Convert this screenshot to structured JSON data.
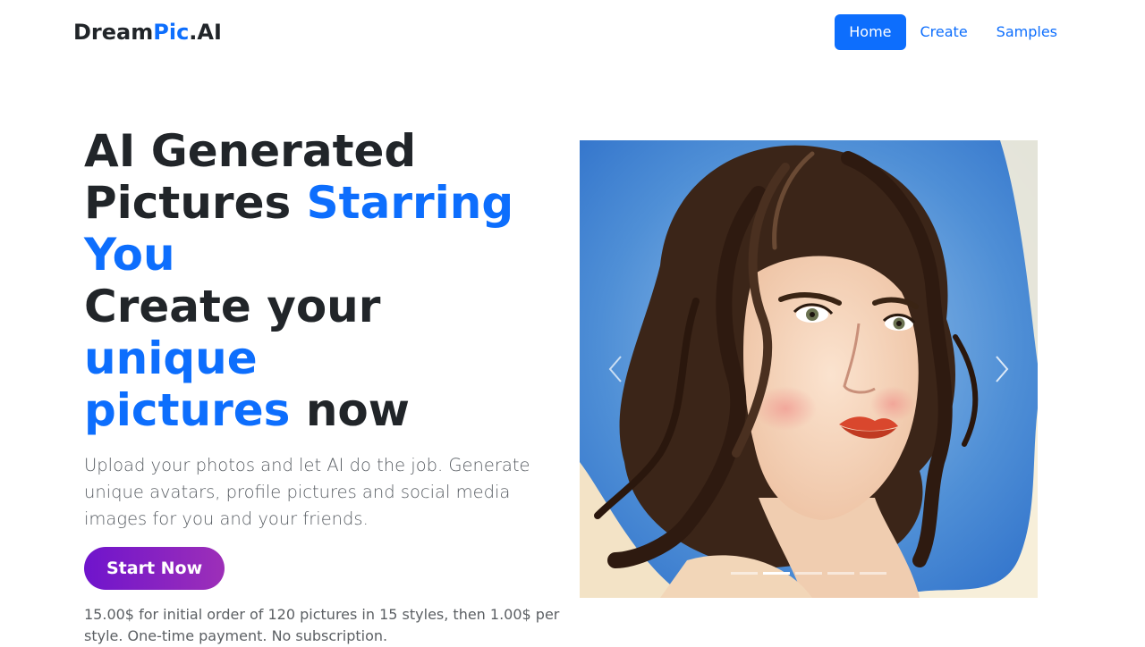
{
  "brand": {
    "part1": "Dream",
    "part2": "Pic",
    "part3": ".AI",
    "accent_color": "#0d6efd"
  },
  "nav": {
    "items": [
      {
        "label": "Home",
        "active": true
      },
      {
        "label": "Create",
        "active": false
      },
      {
        "label": "Samples",
        "active": false
      }
    ]
  },
  "hero": {
    "headline": {
      "line1": "AI Generated",
      "line2a": "Pictures ",
      "line2b": "Starring",
      "line3": "You",
      "line4a": "Create your ",
      "line4b": "unique",
      "line5a": "pictures",
      "line5b": " now"
    },
    "lead": "Upload your photos and let AI do the job. Generate unique avatars, profile pictures and social media images for you and your friends.",
    "cta_label": "Start Now",
    "cta_gradient": [
      "#6f14cc",
      "#9d2fb8"
    ],
    "note": "15.00$ for initial order of 120 pictures in 15 styles, then 1.00$ per style. One-time payment. No subscription."
  },
  "carousel": {
    "image_subject": "watercolor portrait of a woman with dark wavy hair on a blue background",
    "prev_icon": "chevron-left-icon",
    "next_icon": "chevron-right-icon",
    "slide_count": 5,
    "active_slide": 2
  }
}
